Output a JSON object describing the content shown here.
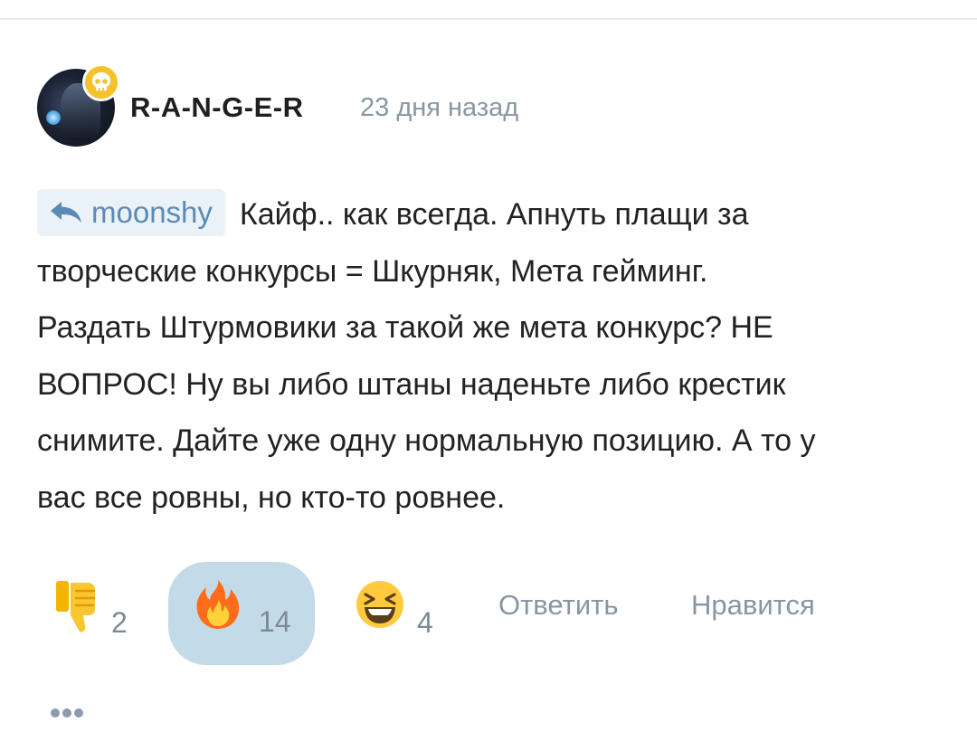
{
  "comment": {
    "author": "R-A-N-G-E-R",
    "timestamp": "23 дня назад",
    "reply_to": "moonshy",
    "text_lines": [
      "Кайф.. как всегда. Апнуть плащи за",
      "творческие конкурсы = Шкурняк, Мета гейминг.",
      "Раздать Штурмовики за такой же мета конкурс? НЕ",
      "ВОПРОС! Ну вы либо штаны наденьте либо крестик",
      "снимите. Дайте уже одну нормальную позицию. А то у",
      "вас все ровны, но кто-то ровнее."
    ]
  },
  "reactions": [
    {
      "icon": "thumbs-down-icon",
      "count": "2",
      "selected": false
    },
    {
      "icon": "fire-icon",
      "count": "14",
      "selected": true
    },
    {
      "icon": "laughing-face-icon",
      "count": "4",
      "selected": false
    }
  ],
  "actions": {
    "reply_label": "Ответить",
    "like_label": "Нравится"
  },
  "icons": {
    "author_badge": "skull-icon",
    "reply_chip": "reply-arrow-icon",
    "more": "more-dots-icon"
  },
  "colors": {
    "accent_link": "#5b8ab6",
    "selected_reaction_bg": "#c3dbe8",
    "muted_text": "#8a96a3",
    "badge": "#f6c22b"
  }
}
